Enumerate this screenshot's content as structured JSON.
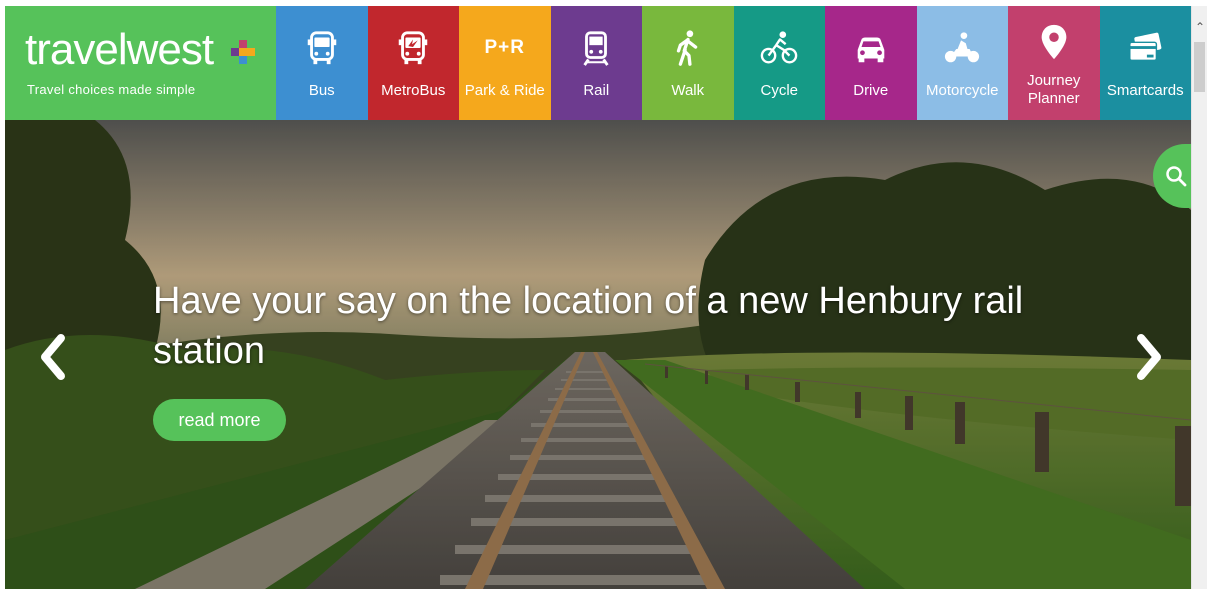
{
  "brand": {
    "name": "travelwest",
    "tagline": "Travel choices made simple",
    "color": "#56c25a"
  },
  "nav": [
    {
      "label": "Bus",
      "icon": "bus-icon",
      "color": "#3d8fd1"
    },
    {
      "label": "MetroBus",
      "icon": "metrobus-icon",
      "color": "#c1272d"
    },
    {
      "label": "Park & Ride",
      "icon": "park-and-ride-icon",
      "icon_text": "P+R",
      "color": "#f5a81c"
    },
    {
      "label": "Rail",
      "icon": "train-icon",
      "color": "#6d3b8f"
    },
    {
      "label": "Walk",
      "icon": "walk-icon",
      "color": "#79b83d"
    },
    {
      "label": "Cycle",
      "icon": "bicycle-icon",
      "color": "#159a86"
    },
    {
      "label": "Drive",
      "icon": "car-icon",
      "color": "#a6278a"
    },
    {
      "label": "Motorcycle",
      "icon": "motorcycle-icon",
      "color": "#8cbde6"
    },
    {
      "label": "Journey Planner",
      "label_line1": "Journey",
      "label_line2": "Planner",
      "icon": "location-pin-icon",
      "color": "#c2406d"
    },
    {
      "label": "Smartcards",
      "icon": "smartcard-icon",
      "color": "#1b8fa0"
    }
  ],
  "hero": {
    "title": "Have your say on the location of a new Henbury rail station",
    "button": "read more",
    "prev_icon": "chevron-left-icon",
    "next_icon": "chevron-right-icon"
  },
  "search": {
    "icon": "search-icon"
  }
}
